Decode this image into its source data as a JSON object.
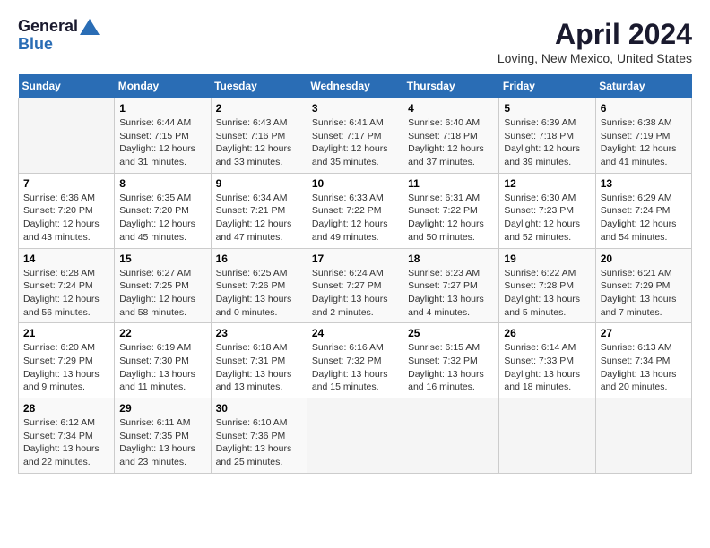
{
  "logo": {
    "line1": "General",
    "line2": "Blue"
  },
  "title": "April 2024",
  "subtitle": "Loving, New Mexico, United States",
  "days_of_week": [
    "Sunday",
    "Monday",
    "Tuesday",
    "Wednesday",
    "Thursday",
    "Friday",
    "Saturday"
  ],
  "weeks": [
    [
      {
        "num": "",
        "info": ""
      },
      {
        "num": "1",
        "info": "Sunrise: 6:44 AM\nSunset: 7:15 PM\nDaylight: 12 hours\nand 31 minutes."
      },
      {
        "num": "2",
        "info": "Sunrise: 6:43 AM\nSunset: 7:16 PM\nDaylight: 12 hours\nand 33 minutes."
      },
      {
        "num": "3",
        "info": "Sunrise: 6:41 AM\nSunset: 7:17 PM\nDaylight: 12 hours\nand 35 minutes."
      },
      {
        "num": "4",
        "info": "Sunrise: 6:40 AM\nSunset: 7:18 PM\nDaylight: 12 hours\nand 37 minutes."
      },
      {
        "num": "5",
        "info": "Sunrise: 6:39 AM\nSunset: 7:18 PM\nDaylight: 12 hours\nand 39 minutes."
      },
      {
        "num": "6",
        "info": "Sunrise: 6:38 AM\nSunset: 7:19 PM\nDaylight: 12 hours\nand 41 minutes."
      }
    ],
    [
      {
        "num": "7",
        "info": "Sunrise: 6:36 AM\nSunset: 7:20 PM\nDaylight: 12 hours\nand 43 minutes."
      },
      {
        "num": "8",
        "info": "Sunrise: 6:35 AM\nSunset: 7:20 PM\nDaylight: 12 hours\nand 45 minutes."
      },
      {
        "num": "9",
        "info": "Sunrise: 6:34 AM\nSunset: 7:21 PM\nDaylight: 12 hours\nand 47 minutes."
      },
      {
        "num": "10",
        "info": "Sunrise: 6:33 AM\nSunset: 7:22 PM\nDaylight: 12 hours\nand 49 minutes."
      },
      {
        "num": "11",
        "info": "Sunrise: 6:31 AM\nSunset: 7:22 PM\nDaylight: 12 hours\nand 50 minutes."
      },
      {
        "num": "12",
        "info": "Sunrise: 6:30 AM\nSunset: 7:23 PM\nDaylight: 12 hours\nand 52 minutes."
      },
      {
        "num": "13",
        "info": "Sunrise: 6:29 AM\nSunset: 7:24 PM\nDaylight: 12 hours\nand 54 minutes."
      }
    ],
    [
      {
        "num": "14",
        "info": "Sunrise: 6:28 AM\nSunset: 7:24 PM\nDaylight: 12 hours\nand 56 minutes."
      },
      {
        "num": "15",
        "info": "Sunrise: 6:27 AM\nSunset: 7:25 PM\nDaylight: 12 hours\nand 58 minutes."
      },
      {
        "num": "16",
        "info": "Sunrise: 6:25 AM\nSunset: 7:26 PM\nDaylight: 13 hours\nand 0 minutes."
      },
      {
        "num": "17",
        "info": "Sunrise: 6:24 AM\nSunset: 7:27 PM\nDaylight: 13 hours\nand 2 minutes."
      },
      {
        "num": "18",
        "info": "Sunrise: 6:23 AM\nSunset: 7:27 PM\nDaylight: 13 hours\nand 4 minutes."
      },
      {
        "num": "19",
        "info": "Sunrise: 6:22 AM\nSunset: 7:28 PM\nDaylight: 13 hours\nand 5 minutes."
      },
      {
        "num": "20",
        "info": "Sunrise: 6:21 AM\nSunset: 7:29 PM\nDaylight: 13 hours\nand 7 minutes."
      }
    ],
    [
      {
        "num": "21",
        "info": "Sunrise: 6:20 AM\nSunset: 7:29 PM\nDaylight: 13 hours\nand 9 minutes."
      },
      {
        "num": "22",
        "info": "Sunrise: 6:19 AM\nSunset: 7:30 PM\nDaylight: 13 hours\nand 11 minutes."
      },
      {
        "num": "23",
        "info": "Sunrise: 6:18 AM\nSunset: 7:31 PM\nDaylight: 13 hours\nand 13 minutes."
      },
      {
        "num": "24",
        "info": "Sunrise: 6:16 AM\nSunset: 7:32 PM\nDaylight: 13 hours\nand 15 minutes."
      },
      {
        "num": "25",
        "info": "Sunrise: 6:15 AM\nSunset: 7:32 PM\nDaylight: 13 hours\nand 16 minutes."
      },
      {
        "num": "26",
        "info": "Sunrise: 6:14 AM\nSunset: 7:33 PM\nDaylight: 13 hours\nand 18 minutes."
      },
      {
        "num": "27",
        "info": "Sunrise: 6:13 AM\nSunset: 7:34 PM\nDaylight: 13 hours\nand 20 minutes."
      }
    ],
    [
      {
        "num": "28",
        "info": "Sunrise: 6:12 AM\nSunset: 7:34 PM\nDaylight: 13 hours\nand 22 minutes."
      },
      {
        "num": "29",
        "info": "Sunrise: 6:11 AM\nSunset: 7:35 PM\nDaylight: 13 hours\nand 23 minutes."
      },
      {
        "num": "30",
        "info": "Sunrise: 6:10 AM\nSunset: 7:36 PM\nDaylight: 13 hours\nand 25 minutes."
      },
      {
        "num": "",
        "info": ""
      },
      {
        "num": "",
        "info": ""
      },
      {
        "num": "",
        "info": ""
      },
      {
        "num": "",
        "info": ""
      }
    ]
  ]
}
